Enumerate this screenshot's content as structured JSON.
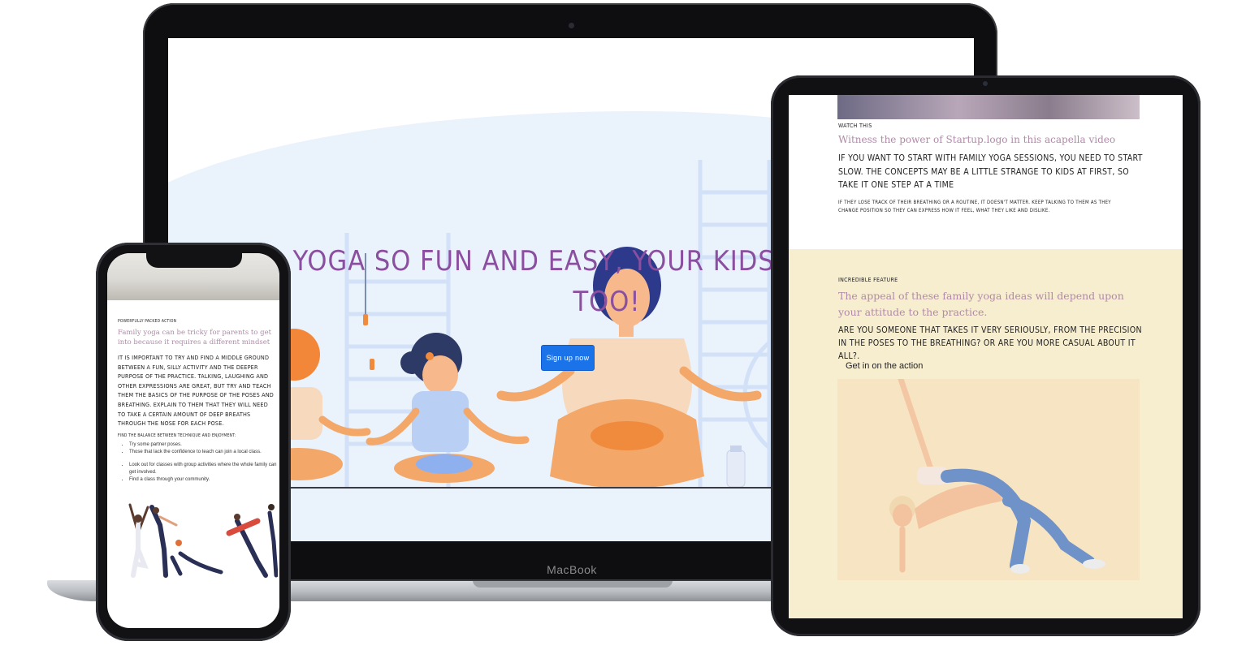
{
  "laptop": {
    "brand_label": "MacBook",
    "hero": {
      "title": "Yoga so fun and easy, your kids can do it too!",
      "cta_label": "Sign up now"
    }
  },
  "tablet": {
    "watch": {
      "eyebrow": "Watch this",
      "heading": "Witness the power of Startup.logo in this acapella video",
      "lead": "If you want to start with family yoga sessions, you need to start slow. The concepts may be a little strange to kids at first, so take it one step at a time",
      "note": "If they lose track of their breathing or a routine, it doesn't matter. Keep talking to them as they change position so they can express how it feel, what they like and dislike."
    },
    "feature": {
      "eyebrow": "Incredible feature",
      "heading": "The appeal of these family yoga ideas will depend upon your attitude to the practice.",
      "lead": "Are you someone that takes it very seriously, from the precision in the poses to the breathing? Or are you more casual about it all?.",
      "link_label": "Get in on the action"
    }
  },
  "phone": {
    "eyebrow": "Powerfully packed action",
    "heading": "Family yoga can be tricky for parents to get into because it requires a different mindset",
    "body": "It is important to try and find a middle ground between a fun, silly activity and the deeper purpose of the practice. Talking, laughing and other expressions are great, but try and teach them the basics of the purpose of the poses and breathing. Explain to them that they will need to take a certain amount of deep breaths through the nose for each pose.",
    "subhead": "Find the balance between technique and enjoyment:",
    "list_a": [
      "Try some partner poses.",
      "Those that lack the confidence to teach can join a local class."
    ],
    "list_b": [
      "Look out for classes with group activities where the whole family can get involved.",
      "Find a class through your community."
    ]
  },
  "colors": {
    "accent_purple": "#8b4fa0",
    "cta_blue": "#1a73e8",
    "feature_bg": "#f7edcf",
    "hero_blob": "#eaf2fc"
  }
}
